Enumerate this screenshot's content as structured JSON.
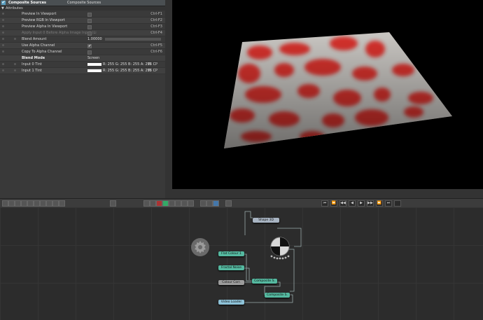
{
  "panel": {
    "checkbox_icon": "check-icon",
    "title": "Composite Sources",
    "subtitle": "Composite Sources",
    "section": "Attributes",
    "rows": [
      {
        "label": "Preview In Viewport",
        "shortcut": "Ctrl-F1"
      },
      {
        "label": "Preview RGB In Viewport",
        "shortcut": "Ctrl-F2"
      },
      {
        "label": "Preview Alpha In Viewport",
        "shortcut": "Ctrl-F3"
      },
      {
        "label": "Apply Input 0 Before Alpha Image Input (Li",
        "shortcut": "Ctrl-F4"
      },
      {
        "label": "Blend Amount",
        "value": "1.00000"
      },
      {
        "label": "Use Alpha Channel",
        "check": "✔",
        "shortcut": "Ctrl-F5"
      },
      {
        "label": "Copy To Alpha Channel",
        "shortcut": "Ctrl-F6"
      },
      {
        "label": "Blend Mode",
        "value": "Screen"
      },
      {
        "label": "Input 0 Tint",
        "rgba": "R: 255 G: 255 B: 255 A: 255 C",
        "w": "W",
        "p": "P"
      },
      {
        "label": "Input 1 Tint",
        "rgba": "R: 255 G: 255 B: 255 A: 255 C",
        "w": "W",
        "p": "P"
      }
    ]
  },
  "colors": {
    "accent": "#5a9fc0",
    "node_teal": "#55b9a0",
    "node_blue": "#8ec2d8",
    "texture_red": "#d8231f"
  },
  "nodes": {
    "shape3d": "Shape 3D",
    "flat_colour": "Flat Colour 1",
    "fractal_noise": "Fractal Noise",
    "colour_corr": "Colour Corr.",
    "composite1": "Composite S.",
    "composite2": "Composite S.",
    "video_loader": "Video Loader"
  },
  "toolbar": {
    "transport": [
      "⏮",
      "⏪",
      "◀◀",
      "◀",
      "▶",
      "▶▶",
      "⏩",
      "⏭"
    ]
  }
}
